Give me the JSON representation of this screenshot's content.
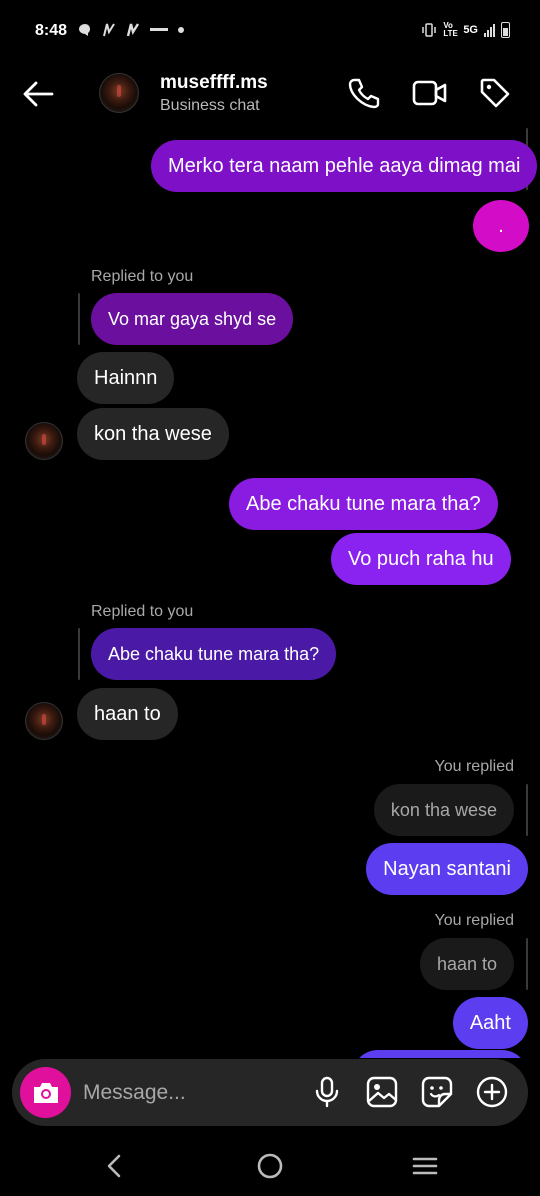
{
  "status_bar": {
    "time": "8:48",
    "network": "5G",
    "volte": "Vo LTE"
  },
  "header": {
    "contact_name": "museffff.ms",
    "subtitle": "Business chat"
  },
  "messages": [
    {
      "text": "Merko tera naam pehle aaya dimag mai"
    },
    {
      "text": "."
    },
    {
      "reply_label": "Replied to you",
      "quoted_text": "Vo mar gaya shyd se"
    },
    {
      "text": "Hainnn"
    },
    {
      "text": "kon tha wese"
    },
    {
      "text": "Abe chaku tune mara tha?"
    },
    {
      "text": "Vo puch raha hu"
    },
    {
      "reply_label": "Replied to you",
      "quoted_text": "Abe chaku tune mara tha?"
    },
    {
      "text": "haan to"
    },
    {
      "reply_label": "You replied",
      "quoted_text": "kon tha wese"
    },
    {
      "text": "Nayan santani"
    },
    {
      "reply_label": "You replied",
      "quoted_text": "haan to"
    },
    {
      "text": "Aaht"
    }
  ],
  "composer": {
    "placeholder": "Message..."
  },
  "colors": {
    "outgoing_purple": "#7e10c8",
    "outgoing_violet": "#5c3df0",
    "incoming_gray": "#262626",
    "camera_pink": "#e0109c"
  },
  "icons": [
    "back-arrow-icon",
    "phone-icon",
    "video-icon",
    "tag-icon",
    "camera-icon",
    "microphone-icon",
    "gallery-icon",
    "sticker-icon",
    "plus-icon",
    "nav-back-icon",
    "nav-home-icon",
    "nav-menu-icon"
  ]
}
